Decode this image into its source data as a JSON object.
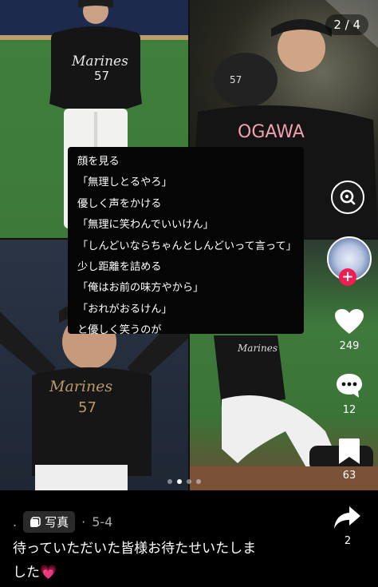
{
  "media": {
    "page_counter": "2 / 4",
    "dots": [
      false,
      true,
      false,
      false
    ]
  },
  "lyrics": [
    "顔を見る",
    "「無理しとるやろ」",
    "優しく声をかける",
    "「無理に笑わんでいいけん」",
    "「しんどいならちゃんとしんどいって言って」",
    "少し距離を詰める",
    "「俺はお前の味方やから」",
    "「おれがおるけん」",
    "と優しく笑うのが"
  ],
  "tiles": {
    "t1": {
      "jersey_text": "Marines",
      "number": "57"
    },
    "t2": {
      "number": "57",
      "name": "OGAWA"
    },
    "t3": {
      "jersey_text": "Marines",
      "number": "57"
    },
    "t4": {
      "jersey_text": "Marines"
    }
  },
  "actions": {
    "likes": "249",
    "comments": "12",
    "saves": "63",
    "shares": "2"
  },
  "post": {
    "dot": ".",
    "type_label": "写真",
    "date": "5-4",
    "caption_line1": "待っていただいた皆様お待たせいたしま",
    "caption_line2": "した",
    "heart_emoji": "💗"
  },
  "colors": {
    "accent": "#ee1d52",
    "background": "#000000"
  }
}
